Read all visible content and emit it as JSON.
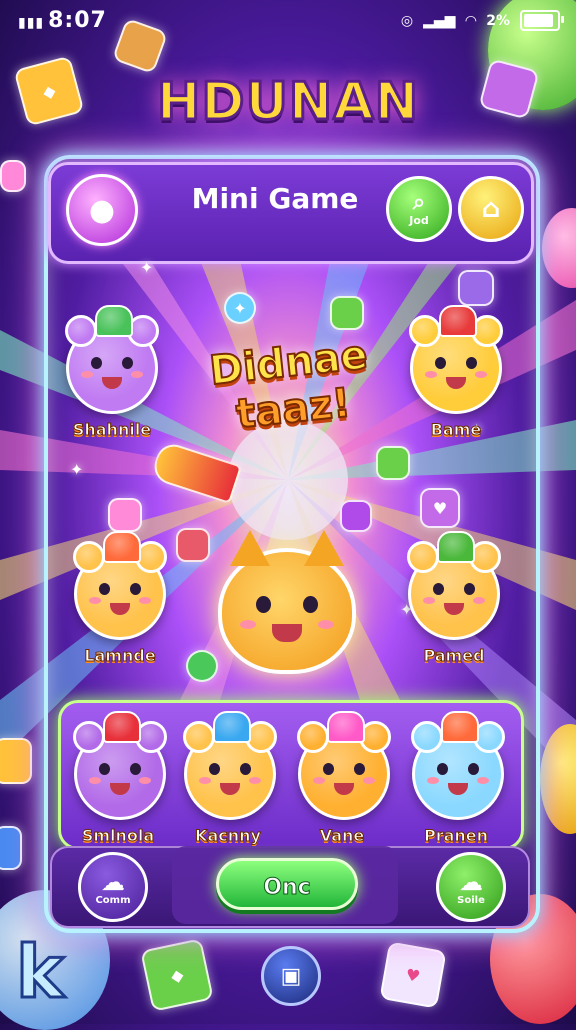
{
  "status_bar": {
    "time": "8:07",
    "signal_icon": "signal-bars-icon",
    "battery_text": "2%",
    "battery_level": 0.8
  },
  "logo": {
    "text": "HDUNAN"
  },
  "header": {
    "title": "Mini Game",
    "avatar_icon": "chat-bubble-icon",
    "green_button_label": "Jod",
    "green_button_icon": "search-icon",
    "yellow_button_icon": "home-icon"
  },
  "stage": {
    "center_title_line1": "Didnae",
    "center_title_line2": "taaz!",
    "characters": [
      {
        "name": "Shahnile",
        "color": "#c07af2",
        "hat": "#49c25a"
      },
      {
        "name": "Bame",
        "color": "#ffcc3a",
        "hat": "#e83a3a"
      },
      {
        "name": "Lamnde",
        "color": "#ffc24a",
        "hat": "#ff6a3a"
      },
      {
        "name": "Pamed",
        "color": "#ffc24a",
        "hat": "#4ab83a"
      }
    ]
  },
  "tray": {
    "characters": [
      {
        "name": "Smlnola",
        "color": "#b26ae8",
        "hat": "#e8303a"
      },
      {
        "name": "Kacnny",
        "color": "#ffc24a",
        "hat": "#3aa8f0"
      },
      {
        "name": "Vane",
        "color": "#ffb030",
        "hat": "#ff5ac8"
      },
      {
        "name": "Pranen",
        "color": "#8ad8ff",
        "hat": "#ff6a3a"
      }
    ]
  },
  "bottom_bar": {
    "left_label": "Comm",
    "left_icon": "ghost-icon",
    "play_label": "Onc",
    "right_label": "Soile",
    "right_icon": "cloud-icon",
    "nav_icon": "bag-icon"
  },
  "colors": {
    "accent_green": "#22b63a",
    "panel_purple": "#6c2cc8",
    "glow_cyan": "#7ee8ff"
  }
}
